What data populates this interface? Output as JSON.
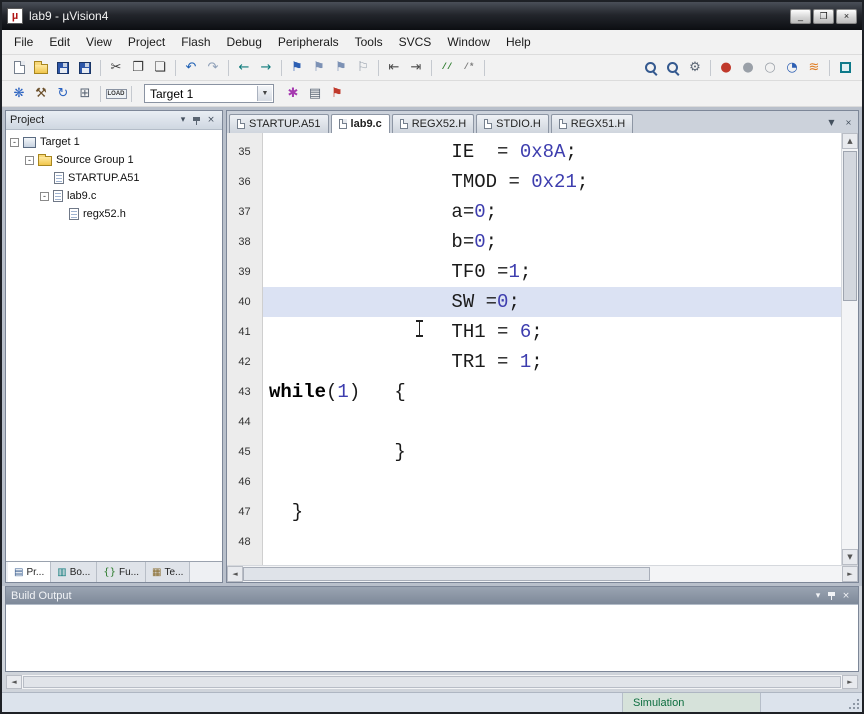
{
  "window": {
    "title": "lab9 - µVision4",
    "controls": [
      {
        "name": "minimize-button",
        "glyph": "_"
      },
      {
        "name": "restore-button",
        "glyph": "❐"
      },
      {
        "name": "close-button",
        "glyph": "×"
      }
    ]
  },
  "menubar": {
    "items": [
      "File",
      "Edit",
      "View",
      "Project",
      "Flash",
      "Debug",
      "Peripherals",
      "Tools",
      "SVCS",
      "Window",
      "Help"
    ]
  },
  "icons": {
    "up": "▲",
    "down": "▼",
    "left": "◄",
    "right": "►",
    "combo_arrow": "▼"
  },
  "toolbar_file": {
    "items": [
      {
        "name": "new-file-icon",
        "kind": "page"
      },
      {
        "name": "open-file-icon",
        "kind": "folder"
      },
      {
        "name": "save-icon",
        "kind": "floppy"
      },
      {
        "name": "save-all-icon",
        "kind": "floppy"
      },
      {
        "sep": true
      },
      {
        "name": "cut-icon",
        "glyph": "✂",
        "color": "#3a3a3a"
      },
      {
        "name": "copy-icon",
        "glyph": "❐",
        "color": "#3a3a3a"
      },
      {
        "name": "paste-icon",
        "glyph": "❏",
        "color": "#3a3a3a"
      },
      {
        "sep": true
      },
      {
        "name": "undo-icon",
        "glyph": "↶",
        "color": "#1d5fb4"
      },
      {
        "name": "redo-icon",
        "glyph": "↷",
        "color": "#8fa0b8"
      },
      {
        "sep": true
      },
      {
        "name": "navigate-back-icon",
        "glyph": "←",
        "color": "#0d7b7b"
      },
      {
        "name": "navigate-forward-icon",
        "glyph": "→",
        "color": "#0d7b7b"
      },
      {
        "sep": true
      },
      {
        "name": "toggle-bookmark-icon",
        "glyph": "⚑",
        "color": "#2d5fb3"
      },
      {
        "name": "previous-bookmark-icon",
        "glyph": "⚑",
        "color": "#7d92b5"
      },
      {
        "name": "next-bookmark-icon",
        "glyph": "⚑",
        "color": "#7d92b5"
      },
      {
        "name": "clear-bookmarks-icon",
        "glyph": "⚐",
        "color": "#8b95a3"
      },
      {
        "sep": true
      },
      {
        "name": "unindent-icon",
        "glyph": "⇤",
        "color": "#4a4a4a"
      },
      {
        "name": "indent-icon",
        "glyph": "⇥",
        "color": "#4a4a4a"
      },
      {
        "sep": true
      },
      {
        "name": "comment-icon",
        "glyph": "//",
        "color": "#2f7d2f",
        "text": true
      },
      {
        "name": "uncomment-icon",
        "glyph": "/*",
        "color": "#7d7d7d",
        "text": true
      },
      {
        "sep": true
      },
      {
        "spacer": true
      },
      {
        "name": "find-in-files-icon",
        "kind": "magnifier"
      },
      {
        "name": "find-icon",
        "kind": "magnifier"
      },
      {
        "name": "goto-icon",
        "glyph": "⚙",
        "color": "#5b6675"
      },
      {
        "sep": true
      },
      {
        "name": "insert-breakpoint-icon",
        "glyph": "●",
        "color": "#c0392b"
      },
      {
        "name": "kill-breakpoints-icon",
        "glyph": "●",
        "color": "#9aa0a8"
      },
      {
        "name": "disable-breakpoints-icon",
        "glyph": "○",
        "color": "#9aa0a8"
      },
      {
        "name": "enable-breakpoints-icon",
        "glyph": "◔",
        "color": "#2d5fb3"
      },
      {
        "name": "bookmarks-spring-icon",
        "glyph": "≋",
        "color": "#e07b1f"
      },
      {
        "sep": true
      },
      {
        "name": "configure-window-icon",
        "kind": "box"
      }
    ]
  },
  "toolbar_build": {
    "target": "Target 1",
    "items_left": [
      {
        "name": "translate-file-icon",
        "glyph": "❋",
        "color": "#2a62c0"
      },
      {
        "name": "build-target-icon",
        "glyph": "⚒",
        "color": "#6b4f2a"
      },
      {
        "name": "rebuild-all-icon",
        "glyph": "↻",
        "color": "#2a62c0"
      },
      {
        "name": "batch-build-icon",
        "glyph": "⊞",
        "color": "#5b6675"
      },
      {
        "sep": true
      },
      {
        "name": "download-icon",
        "kind": "load"
      },
      {
        "sep": true
      }
    ],
    "items_right": [
      {
        "name": "options-for-target-icon",
        "glyph": "✱",
        "color": "#a63ab0"
      },
      {
        "name": "file-extensions-icon",
        "glyph": "▤",
        "color": "#5b6675"
      },
      {
        "name": "target-options-icon",
        "glyph": "⚑",
        "color": "#c0392b"
      }
    ]
  },
  "project": {
    "title": "Project",
    "header_icons": [
      {
        "name": "dock-arrow-icon",
        "glyph": "▾"
      },
      {
        "name": "pin-icon",
        "glyph": "pin"
      },
      {
        "name": "close-panel-icon",
        "glyph": "×"
      }
    ],
    "tree": [
      {
        "label": "Target 1",
        "level": 0,
        "expand": true,
        "icon": "target"
      },
      {
        "label": "Source Group 1",
        "level": 1,
        "expand": true,
        "icon": "folder"
      },
      {
        "label": "STARTUP.A51",
        "level": 2,
        "expand": false,
        "icon": "page"
      },
      {
        "label": "lab9.c",
        "level": 2,
        "expand": true,
        "icon": "page"
      },
      {
        "label": "regx52.h",
        "level": 3,
        "expand": false,
        "icon": "page"
      }
    ],
    "bottom_tabs": [
      {
        "label": "Pr...",
        "icon": "▤",
        "icon_color": "#33598c",
        "active": true
      },
      {
        "label": "Bo...",
        "icon": "▥",
        "icon_color": "#0e7a7a",
        "active": false
      },
      {
        "label": "Fu...",
        "icon": "{}",
        "icon_color": "#2a7a2a",
        "active": false
      },
      {
        "label": "Te...",
        "icon": "▦",
        "icon_color": "#8a6d2f",
        "active": false
      }
    ]
  },
  "editor": {
    "tabs": [
      {
        "label": "STARTUP.A51",
        "active": false
      },
      {
        "label": "lab9.c",
        "active": true
      },
      {
        "label": "REGX52.H",
        "active": false
      },
      {
        "label": "STDIO.H",
        "active": false
      },
      {
        "label": "REGX51.H",
        "active": false
      }
    ],
    "tab_controls": [
      {
        "name": "tab-list-icon",
        "glyph": "▼"
      },
      {
        "name": "close-document-icon",
        "glyph": "×"
      }
    ],
    "palette": {
      "plain": "#1a1a1a",
      "number": "#3d3dae",
      "keyword": "#000000"
    },
    "lines": [
      {
        "num": "35",
        "tokens": [
          {
            "t": "                IE  = ",
            "c": "plain"
          },
          {
            "t": "0x8A",
            "c": "number"
          },
          {
            "t": ";",
            "c": "plain"
          }
        ]
      },
      {
        "num": "36",
        "tokens": [
          {
            "t": "                TMOD = ",
            "c": "plain"
          },
          {
            "t": "0x21",
            "c": "number"
          },
          {
            "t": ";",
            "c": "plain"
          }
        ]
      },
      {
        "num": "37",
        "tokens": [
          {
            "t": "                a=",
            "c": "plain"
          },
          {
            "t": "0",
            "c": "number"
          },
          {
            "t": ";",
            "c": "plain"
          }
        ]
      },
      {
        "num": "38",
        "tokens": [
          {
            "t": "                b=",
            "c": "plain"
          },
          {
            "t": "0",
            "c": "number"
          },
          {
            "t": ";",
            "c": "plain"
          }
        ]
      },
      {
        "num": "39",
        "tokens": [
          {
            "t": "                TF0 =",
            "c": "plain"
          },
          {
            "t": "1",
            "c": "number"
          },
          {
            "t": ";",
            "c": "plain"
          }
        ]
      },
      {
        "num": "40",
        "hl": true,
        "tokens": [
          {
            "t": "                SW =",
            "c": "plain"
          },
          {
            "t": "0",
            "c": "number"
          },
          {
            "t": ";",
            "c": "plain"
          }
        ]
      },
      {
        "num": "41",
        "tokens": [
          {
            "t": "                TH1 = ",
            "c": "plain"
          },
          {
            "t": "6",
            "c": "number"
          },
          {
            "t": ";",
            "c": "plain"
          }
        ]
      },
      {
        "num": "42",
        "tokens": [
          {
            "t": "                TR1 = ",
            "c": "plain"
          },
          {
            "t": "1",
            "c": "number"
          },
          {
            "t": ";",
            "c": "plain"
          }
        ]
      },
      {
        "num": "43",
        "tokens": [
          {
            "t": "while",
            "c": "keyword"
          },
          {
            "t": "(",
            "c": "plain"
          },
          {
            "t": "1",
            "c": "number"
          },
          {
            "t": ")   {",
            "c": "plain"
          }
        ]
      },
      {
        "num": "44",
        "tokens": []
      },
      {
        "num": "45",
        "tokens": [
          {
            "t": "           }",
            "c": "plain"
          }
        ]
      },
      {
        "num": "46",
        "tokens": []
      },
      {
        "num": "47",
        "tokens": [
          {
            "t": "  }",
            "c": "plain"
          }
        ]
      },
      {
        "num": "48",
        "tokens": []
      }
    ]
  },
  "build_output": {
    "title": "Build Output",
    "header_icons": [
      {
        "name": "dock-arrow-icon",
        "glyph": "▾"
      },
      {
        "name": "pin-icon",
        "glyph": "pin"
      },
      {
        "name": "close-panel-icon",
        "glyph": "×"
      }
    ]
  },
  "status": {
    "mode": "Simulation"
  }
}
